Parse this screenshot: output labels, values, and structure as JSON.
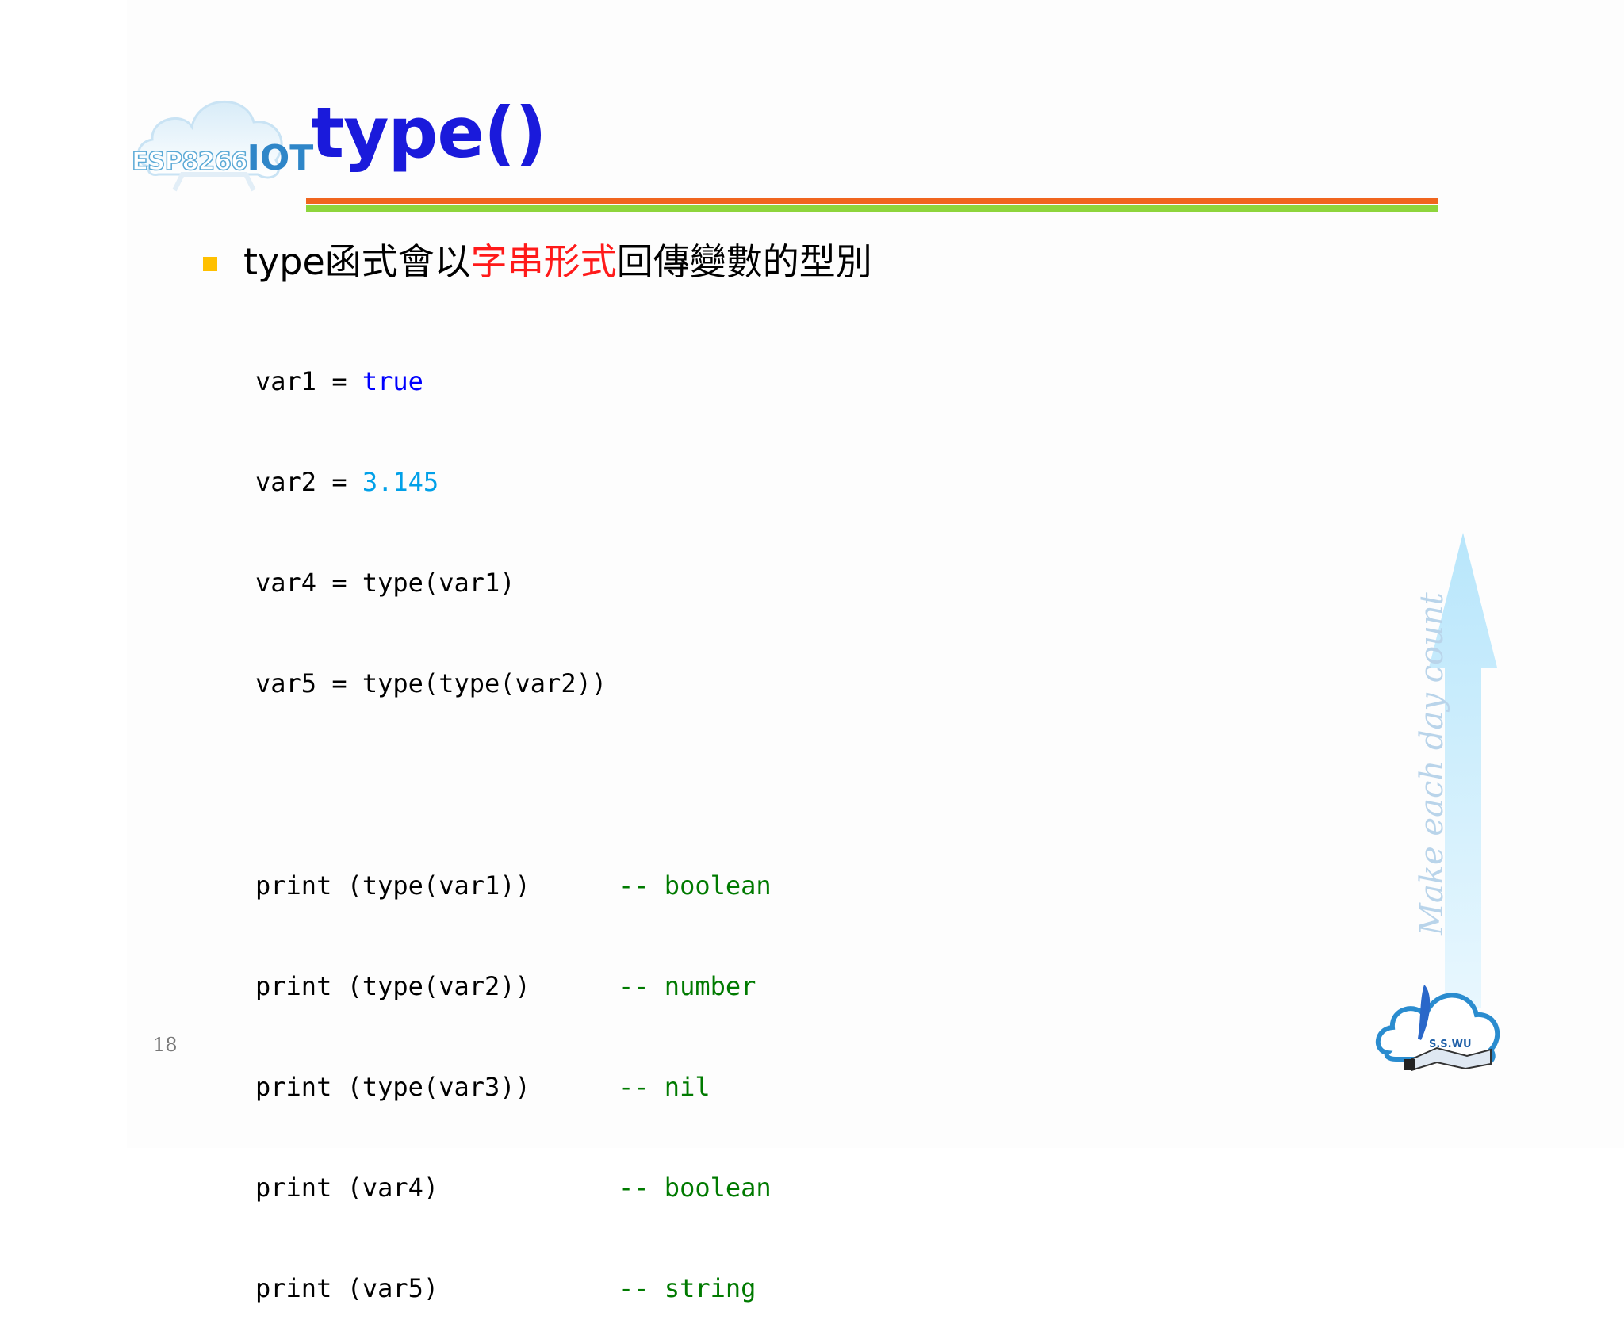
{
  "logo": {
    "text_prefix": "ESP8266",
    "text_suffix": "IOT"
  },
  "title": "type()",
  "bullet": {
    "prefix": "type函式會以",
    "highlight": "字串形式",
    "suffix": "回傳變數的型別"
  },
  "code": {
    "assignments": [
      {
        "lhs": "var1 = ",
        "value": "true",
        "style": "kw-blue"
      },
      {
        "lhs": "var2 = ",
        "value": "3.145",
        "style": "num-cyan"
      },
      {
        "lhs": "var4 = ",
        "value": "type(var1)",
        "style": "plain"
      },
      {
        "lhs": "var5 = ",
        "value": "type(type(var2))",
        "style": "plain"
      }
    ],
    "prints": [
      {
        "stmt": "print (type(var1))",
        "comment": "-- boolean"
      },
      {
        "stmt": "print (type(var2))",
        "comment": "-- number"
      },
      {
        "stmt": "print (type(var3))",
        "comment": "-- nil"
      },
      {
        "stmt": "print (var4)",
        "comment": "-- boolean"
      },
      {
        "stmt": "print (var5)",
        "comment": "-- string"
      }
    ]
  },
  "side_arrow_text": "Make each day count",
  "bottom_logo_text": "S.S.WU",
  "page_number": "18",
  "colors": {
    "title": "#1a1adb",
    "rule_top": "#f0651e",
    "rule_bottom": "#8ed53c",
    "bullet": "#ffc000",
    "highlight": "#ff1a1a",
    "keyword": "#0000ff",
    "number": "#00a0e8",
    "comment": "#007a00"
  }
}
